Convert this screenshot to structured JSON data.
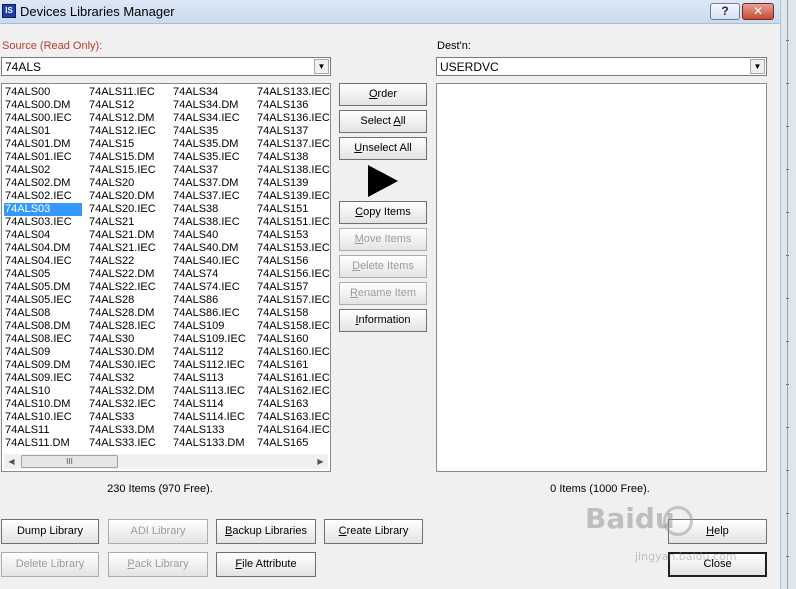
{
  "window": {
    "icon_text": "IS",
    "title": "Devices Libraries Manager",
    "help_label": "?",
    "close_label": "✕"
  },
  "source": {
    "label": "Source (Read Only):",
    "selected": "74ALS",
    "items": [
      "74ALS00",
      "74ALS00.DM",
      "74ALS00.IEC",
      "74ALS01",
      "74ALS01.DM",
      "74ALS01.IEC",
      "74ALS02",
      "74ALS02.DM",
      "74ALS02.IEC",
      "74ALS03",
      "74ALS03.IEC",
      "74ALS04",
      "74ALS04.DM",
      "74ALS04.IEC",
      "74ALS05",
      "74ALS05.DM",
      "74ALS05.IEC",
      "74ALS08",
      "74ALS08.DM",
      "74ALS08.IEC",
      "74ALS09",
      "74ALS09.DM",
      "74ALS09.IEC",
      "74ALS10",
      "74ALS10.DM",
      "74ALS10.IEC",
      "74ALS11",
      "74ALS11.DM",
      "74ALS11.IEC",
      "74ALS12",
      "74ALS12.DM",
      "74ALS12.IEC",
      "74ALS15",
      "74ALS15.DM",
      "74ALS15.IEC",
      "74ALS20",
      "74ALS20.DM",
      "74ALS20.IEC",
      "74ALS21",
      "74ALS21.DM",
      "74ALS21.IEC",
      "74ALS22",
      "74ALS22.DM",
      "74ALS22.IEC",
      "74ALS28",
      "74ALS28.DM",
      "74ALS28.IEC",
      "74ALS30",
      "74ALS30.DM",
      "74ALS30.IEC",
      "74ALS32",
      "74ALS32.DM",
      "74ALS32.IEC",
      "74ALS33",
      "74ALS33.DM",
      "74ALS33.IEC",
      "74ALS34",
      "74ALS34.DM",
      "74ALS34.IEC",
      "74ALS35",
      "74ALS35.DM",
      "74ALS35.IEC",
      "74ALS37",
      "74ALS37.DM",
      "74ALS37.IEC",
      "74ALS38",
      "74ALS38.IEC",
      "74ALS40",
      "74ALS40.DM",
      "74ALS40.IEC",
      "74ALS74",
      "74ALS74.IEC",
      "74ALS86",
      "74ALS86.IEC",
      "74ALS109",
      "74ALS109.IEC",
      "74ALS112",
      "74ALS112.IEC",
      "74ALS113",
      "74ALS113.IEC",
      "74ALS114",
      "74ALS114.IEC",
      "74ALS133",
      "74ALS133.DM",
      "74ALS133.IEC",
      "74ALS136",
      "74ALS136.IEC",
      "74ALS137",
      "74ALS137.IEC",
      "74ALS138",
      "74ALS138.IEC",
      "74ALS139",
      "74ALS139.IEC",
      "74ALS151",
      "74ALS151.IEC",
      "74ALS153",
      "74ALS153.IEC",
      "74ALS156",
      "74ALS156.IEC",
      "74ALS157",
      "74ALS157.IEC",
      "74ALS158",
      "74ALS158.IEC",
      "74ALS160",
      "74ALS160.IEC",
      "74ALS161",
      "74ALS161.IEC",
      "74ALS162.IEC",
      "74ALS163",
      "74ALS163.IEC",
      "74ALS164.IEC",
      "74ALS165"
    ],
    "selected_item": "74ALS03",
    "count": "230 Items (970 Free).",
    "scroll_thumb": "III"
  },
  "dest": {
    "label": "Dest'n:",
    "selected": "USERDVC",
    "count": "0 Items (1000 Free)."
  },
  "middle_buttons": {
    "order": "Order",
    "select_all": "Select All",
    "unselect_all": "Unselect All",
    "copy_items": "Copy Items",
    "move_items": "Move Items",
    "delete_items": "Delete Items",
    "rename_item": "Rename Item",
    "information": "Information"
  },
  "bottom_buttons": {
    "dump_library": "Dump Library",
    "adi_library": "ADI Library",
    "backup_libraries": "Backup Libraries",
    "create_library": "Create Library",
    "delete_library": "Delete Library",
    "pack_library": "Pack Library",
    "file_attribute": "File Attribute",
    "help": "Help",
    "close": "Close"
  },
  "watermark": {
    "brand": "Baidu",
    "sub": "jingyan.baidu.com"
  }
}
